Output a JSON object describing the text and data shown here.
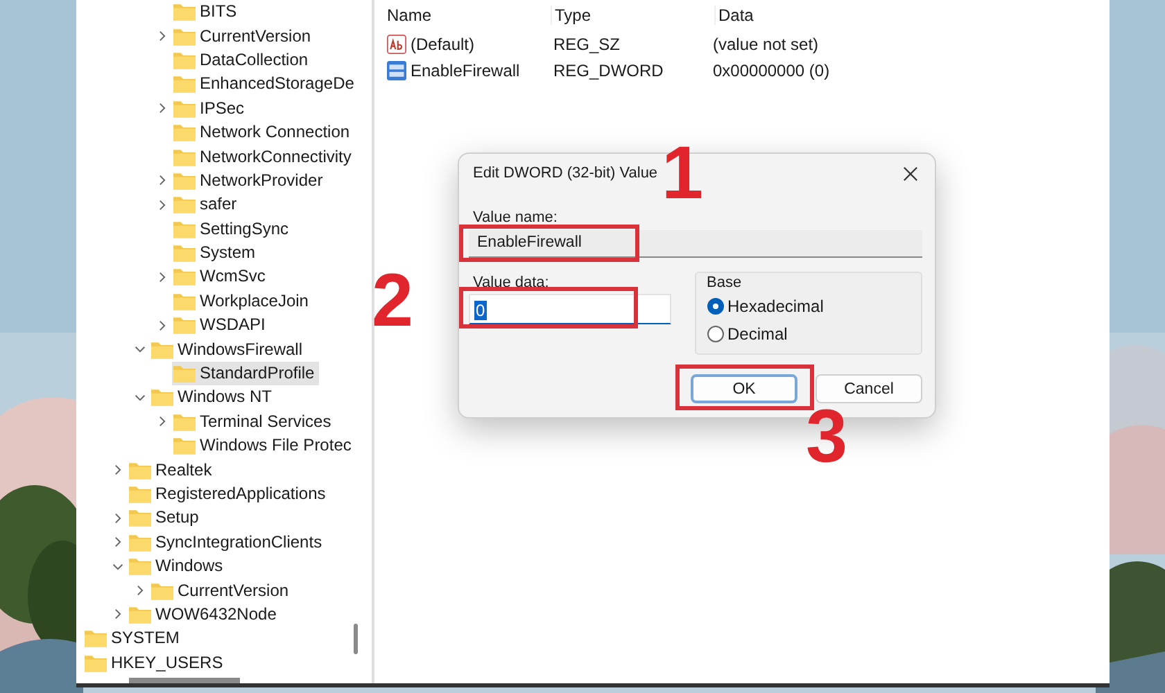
{
  "tree": {
    "items": [
      {
        "children": [
          {
            "children": [
              {
                "children": [
                  {
                    "children": [
                      {
                        "label": "BITS",
                        "selected": false
                      },
                      {
                        "label": "CurrentVersion",
                        "expanded": false,
                        "selected": false
                      },
                      {
                        "label": "DataCollection",
                        "selected": false
                      },
                      {
                        "label": "EnhancedStorageDe",
                        "selected": false
                      },
                      {
                        "label": "IPSec",
                        "expanded": false,
                        "selected": false
                      },
                      {
                        "label": "Network Connection",
                        "selected": false
                      },
                      {
                        "label": "NetworkConnectivity",
                        "selected": false
                      },
                      {
                        "label": "NetworkProvider",
                        "expanded": false,
                        "selected": false
                      },
                      {
                        "label": "safer",
                        "expanded": false,
                        "selected": false
                      },
                      {
                        "label": "SettingSync",
                        "selected": false
                      },
                      {
                        "label": "System",
                        "selected": false
                      },
                      {
                        "label": "WcmSvc",
                        "expanded": false,
                        "selected": false
                      },
                      {
                        "label": "WorkplaceJoin",
                        "selected": false
                      },
                      {
                        "label": "WSDAPI",
                        "expanded": false,
                        "selected": false
                      }
                    ]
                  },
                  {
                    "label": "WindowsFirewall",
                    "expanded": true,
                    "selected": false,
                    "children": [
                      {
                        "label": "StandardProfile",
                        "selected": true
                      }
                    ]
                  },
                  {
                    "label": "Windows NT",
                    "expanded": true,
                    "selected": false,
                    "children": [
                      {
                        "label": "Terminal Services",
                        "expanded": false,
                        "selected": false
                      },
                      {
                        "label": "Windows File Protec",
                        "selected": false
                      }
                    ]
                  }
                ]
              },
              {
                "label": "Realtek",
                "expanded": false,
                "selected": false
              },
              {
                "label": "RegisteredApplications",
                "selected": false
              },
              {
                "label": "Setup",
                "expanded": false,
                "selected": false
              },
              {
                "label": "SyncIntegrationClients",
                "expanded": false,
                "selected": false
              },
              {
                "label": "Windows",
                "expanded": true,
                "selected": false,
                "children": [
                  {
                    "label": "CurrentVersion",
                    "expanded": false,
                    "selected": false
                  }
                ]
              },
              {
                "label": "WOW6432Node",
                "expanded": false,
                "selected": false
              }
            ]
          }
        ]
      },
      {
        "label": "SYSTEM",
        "selected": false
      },
      {
        "label": "HKEY_USERS",
        "selected": false
      }
    ]
  },
  "values": {
    "columns": [
      "Name",
      "Type",
      "Data"
    ],
    "rows": [
      {
        "kind": "string",
        "name": "(Default)",
        "type": "REG_SZ",
        "data": "(value not set)"
      },
      {
        "kind": "binary",
        "name": "EnableFirewall",
        "type": "REG_DWORD",
        "data": "0x00000000 (0)"
      }
    ]
  },
  "dialog": {
    "title": "Edit DWORD (32-bit) Value",
    "value_name": {
      "label": "Value name:",
      "value": "EnableFirewall",
      "highlighted": true
    },
    "value_data": {
      "label": "Value data:",
      "value": "0",
      "text_selected": true,
      "highlighted": true
    },
    "base": {
      "label": "Base",
      "options": [
        {
          "label": "Hexadecimal",
          "selected": true
        },
        {
          "label": "Decimal",
          "selected": false
        }
      ]
    },
    "buttons": [
      {
        "label": "OK",
        "focused": true,
        "highlighted": true
      },
      {
        "label": "Cancel",
        "focused": false,
        "highlighted": false
      }
    ]
  },
  "annotations": [
    {
      "label": "1"
    },
    {
      "label": "2"
    },
    {
      "label": "3"
    }
  ]
}
